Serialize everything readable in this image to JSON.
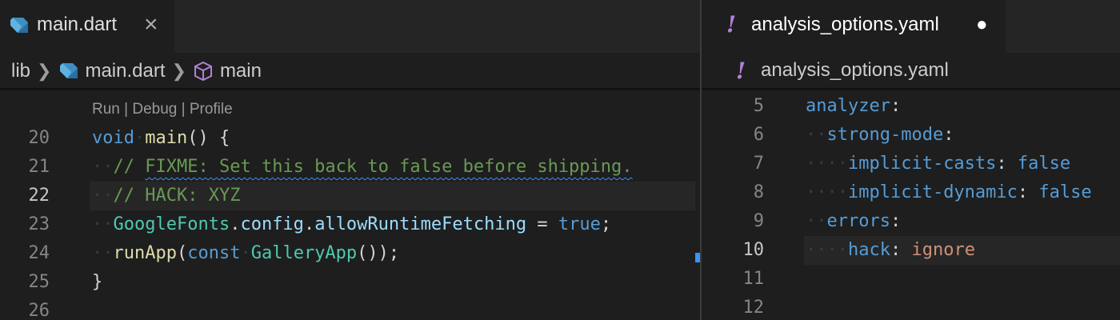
{
  "left": {
    "tab": {
      "label": "main.dart",
      "icon": "dart-icon",
      "close": "×"
    },
    "breadcrumb": [
      "lib",
      "main.dart",
      "main"
    ],
    "codelens": "Run | Debug | Profile",
    "lines": [
      {
        "n": "20",
        "parts": [
          [
            "kw",
            "void"
          ],
          [
            "ws",
            "·"
          ],
          [
            "fn",
            "main"
          ],
          [
            "pn",
            "() {"
          ]
        ]
      },
      {
        "n": "21",
        "parts": [
          [
            "ws",
            "··"
          ],
          [
            "cmt",
            "// "
          ],
          [
            "cmtsq",
            "FIXME: Set this back to false before shipping."
          ]
        ]
      },
      {
        "n": "22",
        "parts": [
          [
            "ws",
            "··"
          ],
          [
            "cmt",
            "// HACK: XYZ"
          ]
        ]
      },
      {
        "n": "23",
        "parts": [
          [
            "ws",
            "··"
          ],
          [
            "cls",
            "GoogleFonts"
          ],
          [
            "pn",
            "."
          ],
          [
            "prop",
            "config"
          ],
          [
            "pn",
            "."
          ],
          [
            "prop",
            "allowRuntimeFetching"
          ],
          [
            "pn",
            " = "
          ],
          [
            "kw",
            "true"
          ],
          [
            "pn",
            ";"
          ]
        ]
      },
      {
        "n": "24",
        "parts": [
          [
            "ws",
            "··"
          ],
          [
            "fn",
            "runApp"
          ],
          [
            "pn",
            "("
          ],
          [
            "kw",
            "const"
          ],
          [
            "ws",
            "·"
          ],
          [
            "cls",
            "GalleryApp"
          ],
          [
            "pn",
            "());"
          ]
        ]
      },
      {
        "n": "25",
        "parts": [
          [
            "pn",
            "}"
          ]
        ]
      },
      {
        "n": "26",
        "parts": []
      }
    ],
    "current_line": "22"
  },
  "right": {
    "tab": {
      "label": "analysis_options.yaml",
      "icon": "yaml-icon",
      "modified": "●"
    },
    "breadcrumb": [
      "analysis_options.yaml"
    ],
    "lines": [
      {
        "n": "5",
        "parts": [
          [
            "yk",
            "analyzer"
          ],
          [
            "pn",
            ":"
          ]
        ]
      },
      {
        "n": "6",
        "parts": [
          [
            "ws",
            "··"
          ],
          [
            "yk",
            "strong-mode"
          ],
          [
            "pn",
            ":"
          ]
        ]
      },
      {
        "n": "7",
        "parts": [
          [
            "ws",
            "····"
          ],
          [
            "yk",
            "implicit-casts"
          ],
          [
            "pn",
            ": "
          ],
          [
            "yv",
            "false"
          ]
        ]
      },
      {
        "n": "8",
        "parts": [
          [
            "ws",
            "····"
          ],
          [
            "yk",
            "implicit-dynamic"
          ],
          [
            "pn",
            ": "
          ],
          [
            "yv",
            "false"
          ]
        ]
      },
      {
        "n": "9",
        "parts": [
          [
            "ws",
            "··"
          ],
          [
            "yk",
            "errors"
          ],
          [
            "pn",
            ":"
          ]
        ]
      },
      {
        "n": "10",
        "parts": [
          [
            "ws",
            "····"
          ],
          [
            "yk",
            "hack"
          ],
          [
            "pn",
            ": "
          ],
          [
            "ys",
            "ignore"
          ]
        ]
      },
      {
        "n": "11",
        "parts": []
      },
      {
        "n": "12",
        "parts": []
      }
    ],
    "current_line": "10"
  },
  "colors": {
    "background": "#1e1e1e",
    "keyword": "#569cd6",
    "function": "#dcdcaa",
    "class": "#4ec9b0",
    "property": "#9cdcfe",
    "comment": "#6a9955",
    "string": "#ce9178",
    "yaml_icon": "#b180d7"
  }
}
